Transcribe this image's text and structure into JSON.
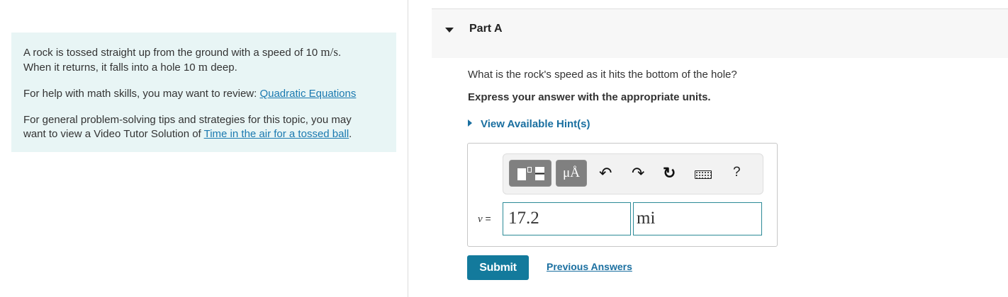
{
  "intro": {
    "p1_a": "A rock is tossed straight up from the ground with a speed of 10 ",
    "p1_unit1": "m/s",
    "p1_b": ".",
    "p1_c": "When it returns, it falls into a hole 10 ",
    "p1_unit2": "m",
    "p1_d": " deep.",
    "p2_text": "For help with math skills, you may want to review: ",
    "p2_link": "Quadratic Equations",
    "p3_text_a": "For general problem-solving tips and strategies for this topic, you may",
    "p3_text_b": "want to view a Video Tutor Solution of ",
    "p3_link": "Time in the air for a tossed ball",
    "p3_end": "."
  },
  "part": {
    "title": "Part A",
    "question": "What is the rock's speed as it hits the bottom of the hole?",
    "instruction": "Express your answer with the appropriate units.",
    "hint_label": "View Available Hint(s)"
  },
  "toolbar": {
    "units_label": "μÅ",
    "undo": "↶",
    "redo": "↷",
    "reset": "↻",
    "help": "?"
  },
  "answer": {
    "variable": "v",
    "equals": " =",
    "value": "17.2",
    "unit": "mi"
  },
  "actions": {
    "submit_label": "Submit",
    "previous_answers_label": "Previous Answers"
  },
  "icons": [
    "templates-icon",
    "units-icon",
    "undo-icon",
    "redo-icon",
    "reset-icon",
    "keyboard-icon",
    "help-icon",
    "caret-down-icon",
    "caret-right-icon"
  ],
  "colors": {
    "intro_bg": "#e8f5f5",
    "link": "#1a79b0",
    "submit_bg": "#137a9c",
    "field_border": "#2b8a97"
  }
}
